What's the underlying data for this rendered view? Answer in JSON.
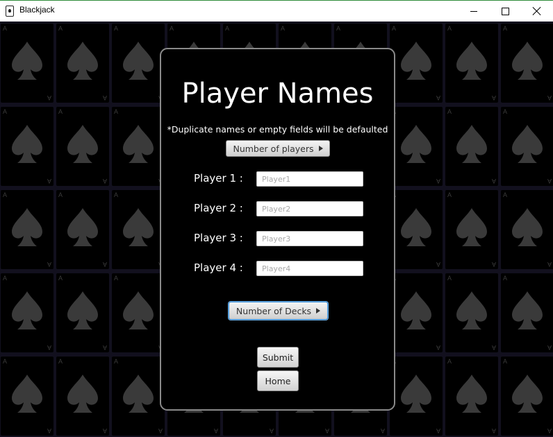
{
  "window": {
    "title": "Blackjack",
    "controls": [
      "minimize-icon",
      "maximize-icon",
      "close-icon"
    ]
  },
  "background": {
    "card_rank": "A",
    "card_suit": "spade-icon",
    "card_color": "#000000",
    "pip_color": "#3a3a3a",
    "table_color": "#12101e"
  },
  "panel": {
    "heading": "Player Names",
    "note": "*Duplicate names or empty fields will be defaulted",
    "players_menu_label": "Number of players",
    "players": [
      {
        "label": "Player 1 :",
        "value": "",
        "placeholder": "Player1"
      },
      {
        "label": "Player 2 :",
        "value": "",
        "placeholder": "Player2"
      },
      {
        "label": "Player 3 :",
        "value": "",
        "placeholder": "Player3"
      },
      {
        "label": "Player 4 :",
        "value": "",
        "placeholder": "Player4"
      }
    ],
    "decks_menu_label": "Number of Decks",
    "submit_label": "Submit",
    "home_label": "Home"
  }
}
